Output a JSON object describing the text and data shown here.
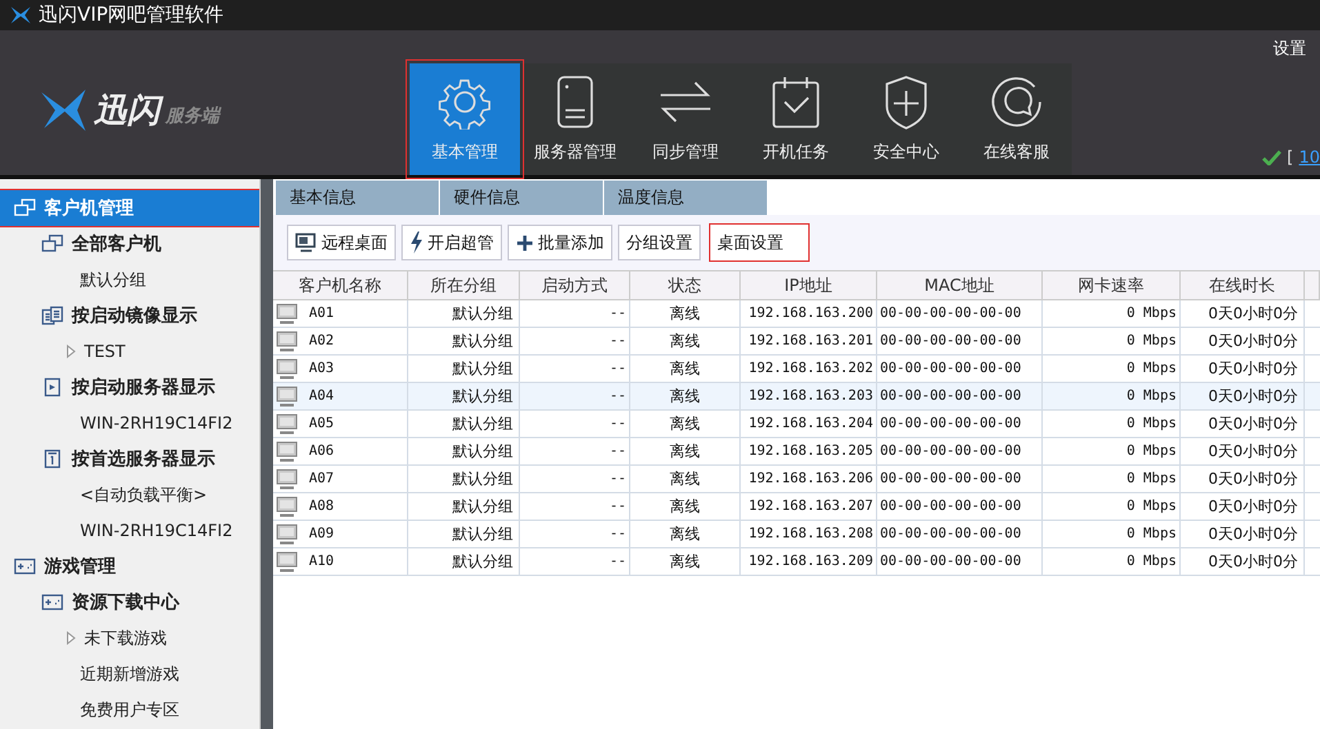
{
  "window": {
    "title": "迅闪VIP网吧管理软件"
  },
  "header": {
    "logo_text": "迅闪",
    "logo_sub": "服务端",
    "settings": "设置",
    "status_open": "[",
    "status_link": "10"
  },
  "nav": [
    {
      "kind": "gear",
      "label": "基本管理",
      "selected": true,
      "highlighted": true
    },
    {
      "kind": "server",
      "label": "服务器管理",
      "selected": false,
      "highlighted": false
    },
    {
      "kind": "sync",
      "label": "同步管理",
      "selected": false,
      "highlighted": false
    },
    {
      "kind": "calendar",
      "label": "开机任务",
      "selected": false,
      "highlighted": false
    },
    {
      "kind": "shield",
      "label": "安全中心",
      "selected": false,
      "highlighted": false
    },
    {
      "kind": "chat",
      "label": "在线客服",
      "selected": false,
      "highlighted": false
    }
  ],
  "sidebar": {
    "items": [
      {
        "kind": "clients",
        "label": "客户机管理",
        "selected": true,
        "highlighted": true,
        "children": [
          {
            "kind": "clients",
            "label": "全部客户机",
            "children": [
              {
                "kind": "leaf",
                "label": "默认分组"
              }
            ]
          },
          {
            "kind": "image",
            "label": "按启动镜像显示",
            "children": [
              {
                "kind": "collapsed",
                "label": "TEST"
              }
            ]
          },
          {
            "kind": "server",
            "label": "按启动服务器显示",
            "children": [
              {
                "kind": "leaf",
                "label": "WIN-2RH19C14FI2"
              }
            ]
          },
          {
            "kind": "preferred",
            "label": "按首选服务器显示",
            "children": [
              {
                "kind": "leaf",
                "label": "<自动负载平衡>"
              },
              {
                "kind": "leaf",
                "label": "WIN-2RH19C14FI2"
              }
            ]
          }
        ]
      },
      {
        "kind": "game",
        "label": "游戏管理",
        "selected": false,
        "highlighted": false,
        "children": [
          {
            "kind": "game",
            "label": "资源下载中心",
            "children": [
              {
                "kind": "collapsed",
                "label": "未下载游戏"
              },
              {
                "kind": "leaf",
                "label": "近期新增游戏"
              },
              {
                "kind": "leaf",
                "label": "免费用户专区"
              }
            ]
          }
        ]
      }
    ]
  },
  "tabs": [
    {
      "label": "基本信息"
    },
    {
      "label": "硬件信息"
    },
    {
      "label": "温度信息"
    }
  ],
  "toolbar": [
    {
      "kind": "remote",
      "label": "远程桌面",
      "highlighted": false
    },
    {
      "kind": "bolt",
      "label": "开启超管",
      "highlighted": false
    },
    {
      "kind": "plus",
      "label": "批量添加",
      "highlighted": false
    },
    {
      "kind": "text",
      "label": "分组设置",
      "highlighted": false
    },
    {
      "kind": "text",
      "label": "桌面设置",
      "highlighted": true
    }
  ],
  "table": {
    "columns": [
      "客户机名称",
      "所在分组",
      "启动方式",
      "状态",
      "IP地址",
      "MAC地址",
      "网卡速率",
      "在线时长"
    ],
    "rows": [
      {
        "selected": false,
        "cells": [
          "A01",
          "默认分组",
          "--",
          "离线",
          "192.168.163.200",
          "00-00-00-00-00-00",
          "0 Mbps",
          "0天0小时0分"
        ]
      },
      {
        "selected": false,
        "cells": [
          "A02",
          "默认分组",
          "--",
          "离线",
          "192.168.163.201",
          "00-00-00-00-00-00",
          "0 Mbps",
          "0天0小时0分"
        ]
      },
      {
        "selected": false,
        "cells": [
          "A03",
          "默认分组",
          "--",
          "离线",
          "192.168.163.202",
          "00-00-00-00-00-00",
          "0 Mbps",
          "0天0小时0分"
        ]
      },
      {
        "selected": true,
        "cells": [
          "A04",
          "默认分组",
          "--",
          "离线",
          "192.168.163.203",
          "00-00-00-00-00-00",
          "0 Mbps",
          "0天0小时0分"
        ]
      },
      {
        "selected": false,
        "cells": [
          "A05",
          "默认分组",
          "--",
          "离线",
          "192.168.163.204",
          "00-00-00-00-00-00",
          "0 Mbps",
          "0天0小时0分"
        ]
      },
      {
        "selected": false,
        "cells": [
          "A06",
          "默认分组",
          "--",
          "离线",
          "192.168.163.205",
          "00-00-00-00-00-00",
          "0 Mbps",
          "0天0小时0分"
        ]
      },
      {
        "selected": false,
        "cells": [
          "A07",
          "默认分组",
          "--",
          "离线",
          "192.168.163.206",
          "00-00-00-00-00-00",
          "0 Mbps",
          "0天0小时0分"
        ]
      },
      {
        "selected": false,
        "cells": [
          "A08",
          "默认分组",
          "--",
          "离线",
          "192.168.163.207",
          "00-00-00-00-00-00",
          "0 Mbps",
          "0天0小时0分"
        ]
      },
      {
        "selected": false,
        "cells": [
          "A09",
          "默认分组",
          "--",
          "离线",
          "192.168.163.208",
          "00-00-00-00-00-00",
          "0 Mbps",
          "0天0小时0分"
        ]
      },
      {
        "selected": false,
        "cells": [
          "A10",
          "默认分组",
          "--",
          "离线",
          "192.168.163.209",
          "00-00-00-00-00-00",
          "0 Mbps",
          "0天0小时0分"
        ]
      }
    ]
  }
}
